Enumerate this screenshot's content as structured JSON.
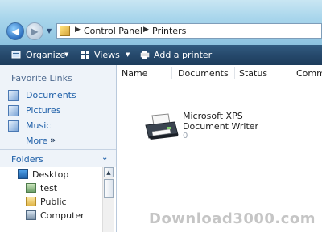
{
  "address": {
    "breadcrumb": [
      "Control Panel",
      "Printers"
    ]
  },
  "toolbar": {
    "organize_label": "Organize",
    "views_label": "Views",
    "add_printer_label": "Add a printer"
  },
  "sidebar": {
    "favorites_header": "Favorite Links",
    "favorites": [
      {
        "label": "Documents",
        "icon": "documents-icon"
      },
      {
        "label": "Pictures",
        "icon": "pictures-icon"
      },
      {
        "label": "Music",
        "icon": "music-icon"
      }
    ],
    "more_label": "More",
    "more_chevron": "»",
    "folders_label": "Folders",
    "tree": [
      {
        "label": "Desktop",
        "icon": "desktop-icon"
      },
      {
        "label": "test",
        "icon": "user-folder-icon"
      },
      {
        "label": "Public",
        "icon": "folder-icon"
      },
      {
        "label": "Computer",
        "icon": "computer-icon"
      }
    ]
  },
  "columns": [
    "Name",
    "Documents",
    "Status",
    "Comm"
  ],
  "printer": {
    "name": "Microsoft XPS Document Writer",
    "documents": "0",
    "icon": "printer-icon"
  },
  "watermark": "Download3000.com",
  "colors": {
    "toolbar_bg": "#26496c",
    "address_bg": "#a9d6ec",
    "link_blue": "#1e5fa8",
    "pane_bg": "#eef3f9"
  }
}
